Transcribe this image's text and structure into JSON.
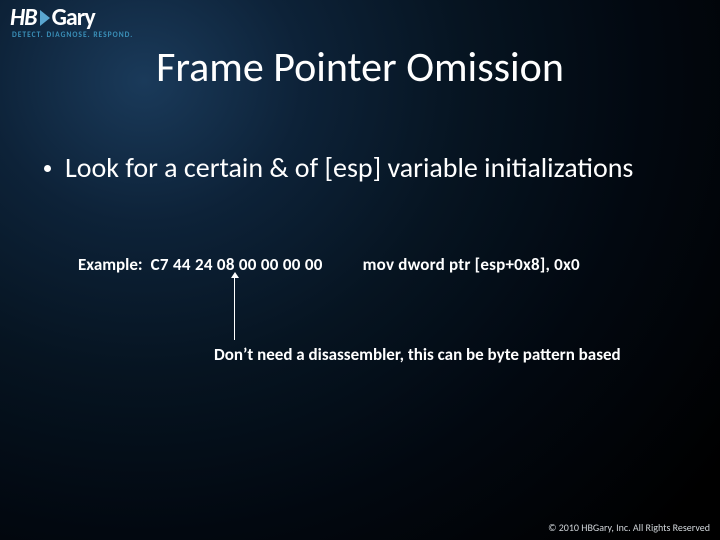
{
  "logo": {
    "hb": "HB",
    "gary": "Gary",
    "tag": "DETECT.  DIAGNOSE.  RESPOND."
  },
  "title": "Frame Pointer Omission",
  "bullet": "Look for a certain & of [esp] variable initializations",
  "example": {
    "label": "Example:",
    "bytes": "C7 44 24 08 00 00 00 00",
    "asm": "mov dword ptr [esp+0x8], 0x0"
  },
  "note": "Don’t need a disassembler, this can be byte pattern based",
  "footer": "© 2010 HBGary, Inc. All Rights Reserved"
}
